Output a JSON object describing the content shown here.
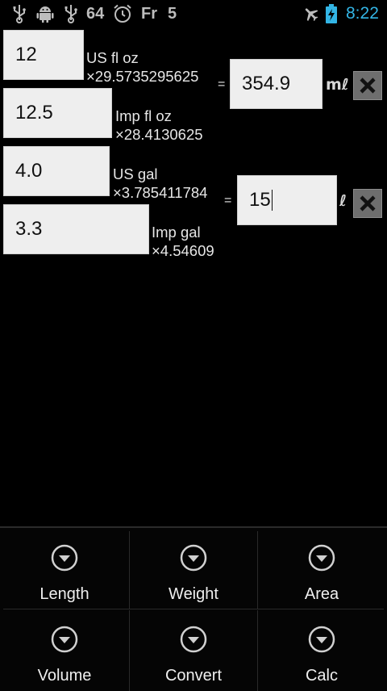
{
  "status_bar": {
    "icons_left": [
      "usb-icon",
      "android-debug-icon",
      "usb-icon",
      "alarm-clock-icon"
    ],
    "battery_level": "64",
    "day": "Fr",
    "date": "5",
    "icons_right": [
      "airplane-mode-icon",
      "battery-charging-icon"
    ],
    "time": "8:22",
    "clock_color": "#33b5e5"
  },
  "converter": {
    "group1": {
      "inputs": [
        {
          "value": "12",
          "unit": "US fl oz",
          "factor": "×29.5735295625"
        },
        {
          "value": "12.5",
          "unit": "Imp fl oz",
          "factor": "×28.4130625"
        }
      ],
      "equals": "=",
      "result_value": "354.9",
      "result_unit": "mℓ",
      "clear_icon": "close-icon"
    },
    "group2": {
      "inputs": [
        {
          "value": "4.0",
          "unit": "US gal",
          "factor": "×3.785411784"
        },
        {
          "value": "3.3",
          "unit": "Imp gal",
          "factor": "×4.54609"
        }
      ],
      "equals": "=",
      "result_value": "15",
      "result_unit": "ℓ",
      "clear_icon": "close-icon"
    }
  },
  "menu": {
    "items": [
      {
        "label": "Length",
        "icon": "chevron-down-circle-icon"
      },
      {
        "label": "Weight",
        "icon": "chevron-down-circle-icon"
      },
      {
        "label": "Area",
        "icon": "chevron-down-circle-icon"
      },
      {
        "label": "Volume",
        "icon": "chevron-down-circle-icon"
      },
      {
        "label": "Convert",
        "icon": "chevron-down-circle-icon"
      },
      {
        "label": "Calc",
        "icon": "chevron-down-circle-icon"
      }
    ]
  }
}
